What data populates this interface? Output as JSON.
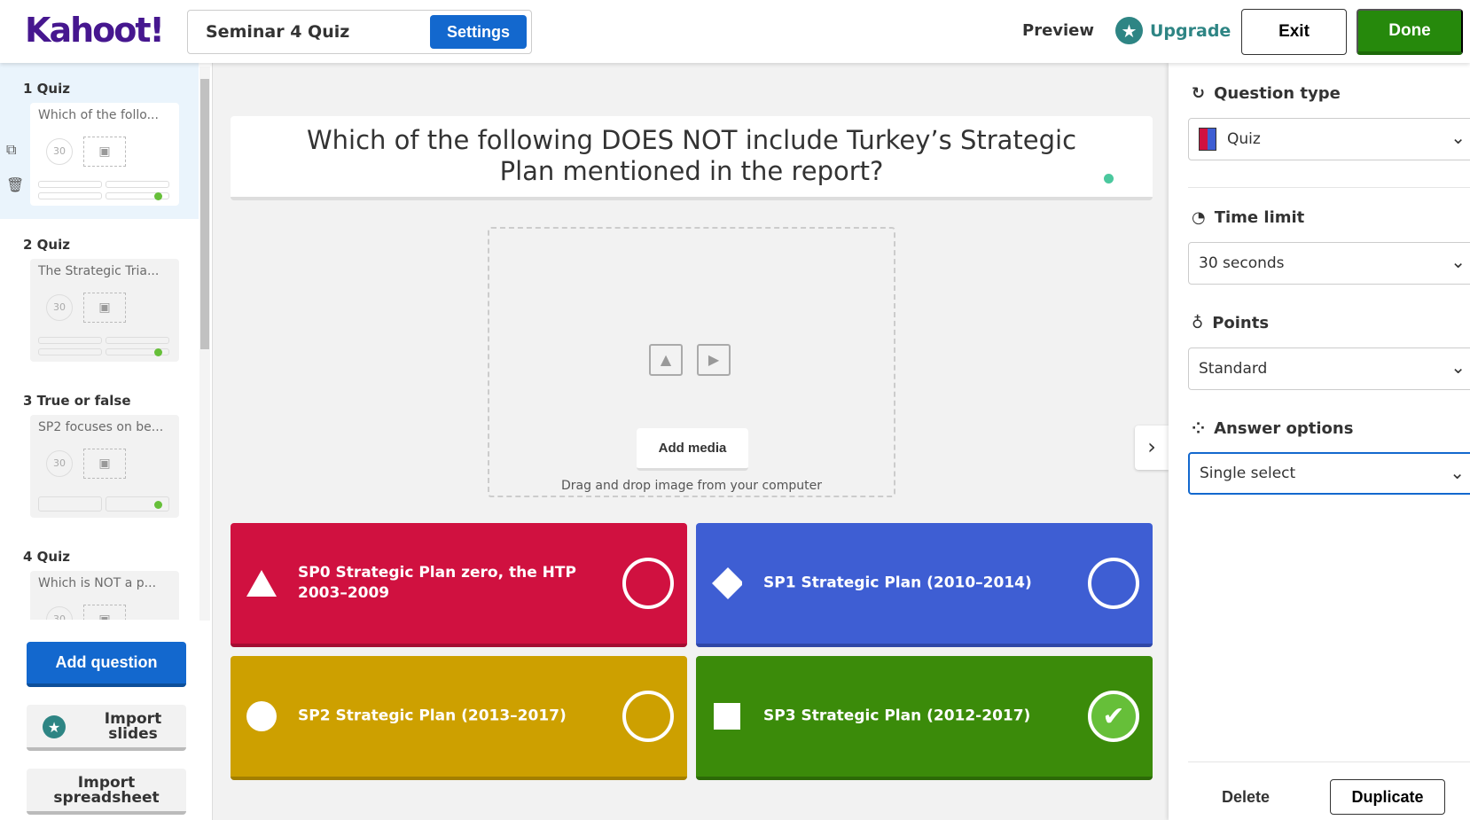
{
  "header": {
    "logo": "Kahoot!",
    "quiz_title": "Seminar 4 Quiz",
    "settings": "Settings",
    "preview": "Preview",
    "upgrade": "Upgrade",
    "exit": "Exit",
    "done": "Done"
  },
  "sidebar": {
    "slides": [
      {
        "label": "1  Quiz",
        "text": "Which of the follo...",
        "time": "30"
      },
      {
        "label": "2  Quiz",
        "text": "The Strategic Tria...",
        "time": "30"
      },
      {
        "label": "3  True or false",
        "text": "SP2 focuses on be...",
        "time": "30"
      },
      {
        "label": "4  Quiz",
        "text": "Which is NOT a p...",
        "time": "30"
      }
    ],
    "add_question": "Add question",
    "import_slides": "Import slides",
    "import_spreadsheet": "Import spreadsheet"
  },
  "question": {
    "text": "Which of the following DOES NOT include Turkey’s Strategic Plan mentioned in the report?",
    "add_media": "Add media",
    "drag_hint": "Drag and drop image from your computer"
  },
  "answers": [
    {
      "text": "SP0 Strategic Plan zero, the HTP 2003–2009",
      "color": "#d01140",
      "shape": "triangle",
      "correct": false
    },
    {
      "text": "SP1 Strategic Plan (2010–2014)",
      "color": "#3e5ed3",
      "shape": "diamond",
      "correct": false
    },
    {
      "text": "SP2 Strategic Plan (2013–2017)",
      "color": "#cda000",
      "shape": "circle",
      "correct": false
    },
    {
      "text": "SP3 Strategic Plan (2012-2017)",
      "color": "#3b8b0a",
      "shape": "square",
      "correct": true
    }
  ],
  "panel": {
    "question_type_label": "Question type",
    "question_type": "Quiz",
    "time_limit_label": "Time limit",
    "time_limit": "30 seconds",
    "points_label": "Points",
    "points": "Standard",
    "answer_options_label": "Answer options",
    "answer_options": "Single select",
    "delete": "Delete",
    "duplicate": "Duplicate"
  }
}
